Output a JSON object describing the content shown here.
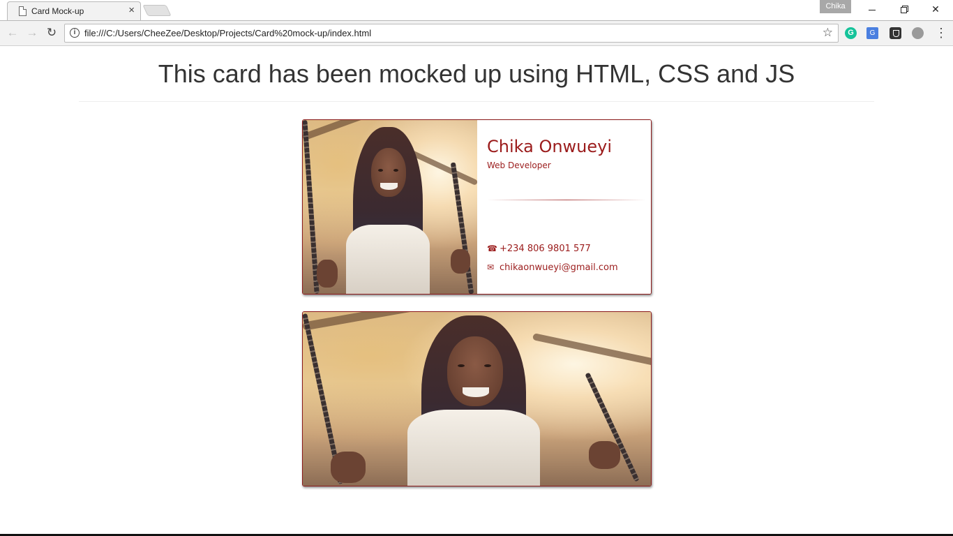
{
  "browser": {
    "tab_title": "Card Mock-up",
    "tab_close": "×",
    "profile_name": "Chika",
    "url": "file:///C:/Users/CheeZee/Desktop/Projects/Card%20mock-up/index.html",
    "window_close": "✕",
    "back": "←",
    "forward": "→",
    "reload": "↻",
    "star": "☆",
    "info": "i",
    "menu": "⋮",
    "extensions": [
      "grammarly-icon",
      "google-translate-icon",
      "shield-icon",
      "cloud-icon"
    ]
  },
  "page": {
    "heading": "This card has been mocked up using HTML, CSS and JS"
  },
  "card": {
    "name": "Chika Onwueyi",
    "role": "Web Developer",
    "phone_icon": "☎",
    "phone": "+234 806 9801 577",
    "email_icon": "✉",
    "email": "chikaonwueyi@gmail.com",
    "accent_color": "#9b1c1c"
  }
}
